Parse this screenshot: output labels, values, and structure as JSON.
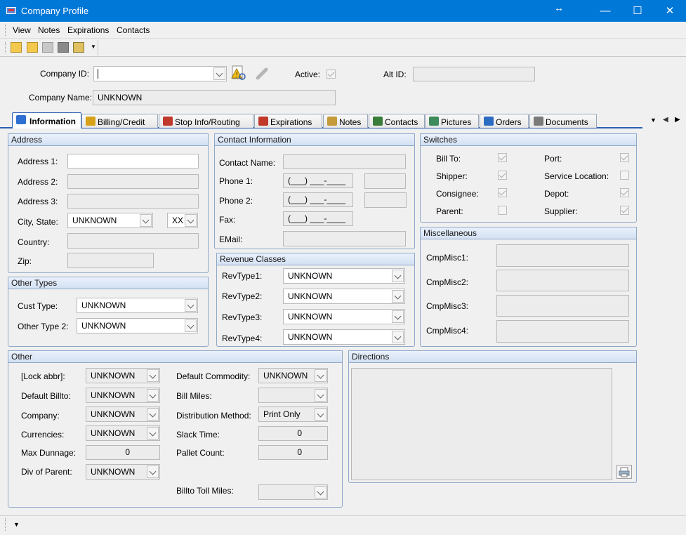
{
  "window": {
    "title": "Company Profile",
    "minimize": "—",
    "maximize": "☐",
    "close": "✕"
  },
  "menu": [
    "View",
    "Notes",
    "Expirations",
    "Contacts"
  ],
  "header": {
    "company_id_label": "Company ID:",
    "company_id_value": "",
    "active_label": "Active:",
    "alt_id_label": "Alt ID:",
    "alt_id_value": "",
    "company_name_label": "Company Name:",
    "company_name_value": "UNKNOWN"
  },
  "tabs": [
    {
      "label": "Information",
      "icon": "info-icon",
      "color": "#2f6fd0"
    },
    {
      "label": "Billing/Credit",
      "icon": "coins-icon",
      "color": "#d7a21a"
    },
    {
      "label": "Stop Info/Routing",
      "icon": "truck-icon",
      "color": "#c0392b"
    },
    {
      "label": "Expirations",
      "icon": "calendar-icon",
      "color": "#c0392b"
    },
    {
      "label": "Notes",
      "icon": "pencil-icon",
      "color": "#c49a3a"
    },
    {
      "label": "Contacts",
      "icon": "people-icon",
      "color": "#3a7d3a"
    },
    {
      "label": "Pictures",
      "icon": "picture-icon",
      "color": "#3d8a5a"
    },
    {
      "label": "Orders",
      "icon": "orders-icon",
      "color": "#2c6bc2"
    },
    {
      "label": "Documents",
      "icon": "documents-icon",
      "color": "#7a7a7a"
    }
  ],
  "address": {
    "title": "Address",
    "address1_label": "Address 1:",
    "address1_value": "",
    "address2_label": "Address 2:",
    "address2_value": "",
    "address3_label": "Address 3:",
    "address3_value": "",
    "city_state_label": "City, State:",
    "city_value": "UNKNOWN",
    "state_value": "XX",
    "country_label": "Country:",
    "country_value": "",
    "zip_label": "Zip:",
    "zip_value": ""
  },
  "other_types": {
    "title": "Other Types",
    "cust_type_label": "Cust Type:",
    "cust_type_value": "UNKNOWN",
    "other_type2_label": "Other Type 2:",
    "other_type2_value": "UNKNOWN"
  },
  "contact": {
    "title": "Contact Information",
    "name_label": "Contact Name:",
    "name_value": "",
    "phone1_label": "Phone 1:",
    "phone1_value": "(___) ___-____",
    "phone1_ext": "",
    "phone2_label": "Phone 2:",
    "phone2_value": "(___) ___-____",
    "phone2_ext": "",
    "fax_label": "Fax:",
    "fax_value": "(___) ___-____",
    "email_label": "EMail:",
    "email_value": ""
  },
  "revenue": {
    "title": "Revenue Classes",
    "items": [
      {
        "label": "RevType1:",
        "value": "UNKNOWN"
      },
      {
        "label": "RevType2:",
        "value": "UNKNOWN"
      },
      {
        "label": "RevType3:",
        "value": "UNKNOWN"
      },
      {
        "label": "RevType4:",
        "value": "UNKNOWN"
      }
    ]
  },
  "switches": {
    "title": "Switches",
    "left": [
      {
        "label": "Bill To:",
        "checked": true
      },
      {
        "label": "Shipper:",
        "checked": true
      },
      {
        "label": "Consignee:",
        "checked": true
      },
      {
        "label": "Parent:",
        "checked": false
      }
    ],
    "right": [
      {
        "label": "Port:",
        "checked": true
      },
      {
        "label": "Service Location:",
        "checked": false
      },
      {
        "label": "Depot:",
        "checked": true
      },
      {
        "label": "Supplier:",
        "checked": true
      }
    ]
  },
  "misc": {
    "title": "Miscellaneous",
    "items": [
      {
        "label": "CmpMisc1:",
        "value": ""
      },
      {
        "label": "CmpMisc2:",
        "value": ""
      },
      {
        "label": "CmpMisc3:",
        "value": ""
      },
      {
        "label": "CmpMisc4:",
        "value": ""
      }
    ]
  },
  "other": {
    "title": "Other",
    "lock_abbr_label": "[Lock abbr]:",
    "lock_abbr_value": "UNKNOWN",
    "default_billto_label": "Default Billto:",
    "default_billto_value": "UNKNOWN",
    "company_label": "Company:",
    "company_value": "UNKNOWN",
    "currencies_label": "Currencies:",
    "currencies_value": "UNKNOWN",
    "max_dunnage_label": "Max Dunnage:",
    "max_dunnage_value": "0",
    "div_parent_label": "Div of Parent:",
    "div_parent_value": "UNKNOWN",
    "default_commodity_label": "Default Commodity:",
    "default_commodity_value": "UNKNOWN",
    "bill_miles_label": "Bill Miles:",
    "bill_miles_value": "",
    "distribution_label": "Distribution Method:",
    "distribution_value": "Print Only",
    "slack_time_label": "Slack Time:",
    "slack_time_value": "0",
    "pallet_count_label": "Pallet Count:",
    "pallet_count_value": "0",
    "billto_toll_label": "Billto Toll Miles:",
    "billto_toll_value": ""
  },
  "directions": {
    "title": "Directions",
    "value": ""
  },
  "colors": {
    "titlebar": "#0078d7",
    "tab_accent": "#2b5fb3",
    "group_header": "#d3e1f3"
  }
}
